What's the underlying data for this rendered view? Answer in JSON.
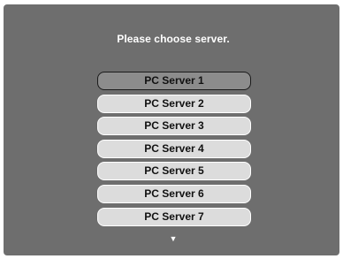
{
  "prompt": "Please choose server.",
  "servers": [
    {
      "label": "PC Server 1",
      "selected": true
    },
    {
      "label": "PC Server 2",
      "selected": false
    },
    {
      "label": "PC Server 3",
      "selected": false
    },
    {
      "label": "PC Server 4",
      "selected": false
    },
    {
      "label": "PC Server 5",
      "selected": false
    },
    {
      "label": "PC Server 6",
      "selected": false
    },
    {
      "label": "PC Server 7",
      "selected": false
    }
  ],
  "scroll_indicator": {
    "icon": "scroll-down-arrow-icon",
    "glyph": "▼"
  },
  "colors": {
    "screen_background": "#6e6e6e",
    "button_background": "#dcdcdc",
    "selected_button_background": "#8c8c8c",
    "text": "#ffffff"
  }
}
